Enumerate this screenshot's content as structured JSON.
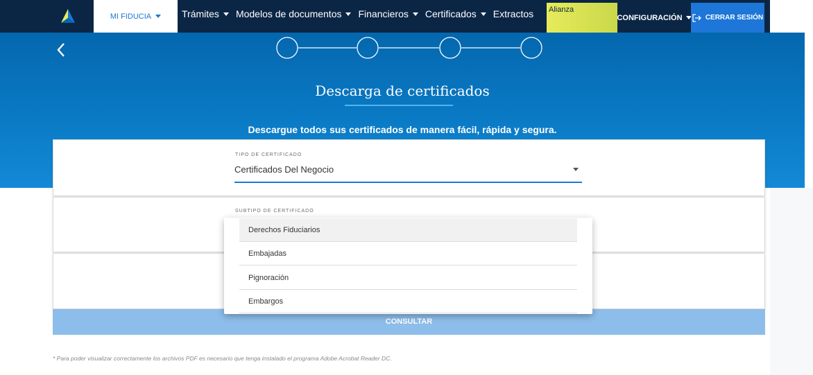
{
  "nav": {
    "mi_fiducia": "MI FIDUCIA",
    "items": [
      "Trámites",
      "Modelos de documentos",
      "Financieros",
      "Certificados",
      "Extractos"
    ],
    "alianza": "Alianza",
    "configuracion": "CONFIGURACIÓN",
    "cerrar_sesion": "CERRAR SESIÓN"
  },
  "hero": {
    "title": "Descarga de certificados",
    "subtitle": "Descargue todos sus certificados de manera fácil, rápida y segura."
  },
  "form": {
    "tipo_label": "TIPO DE CERTIFICADO",
    "tipo_value": "Certificados Del Negocio",
    "subtipo_label": "SUBTIPO DE CERTIFICADO",
    "subtipo_options": [
      "Derechos Fiduciarios",
      "Embajadas",
      "Pignoración",
      "Embargos"
    ],
    "consultar": "CONSULTAR"
  },
  "footnote": "* Para poder visualizar correctamente los archivos PDF es necesario que tenga instalado el programa Adobe Acrobat Reader DC.",
  "colors": {
    "navy": "#0b2645",
    "blue": "#1d76d8",
    "hero": "#0a7ac5",
    "button": "#8dbdea",
    "accent": "#e7eb5b"
  }
}
